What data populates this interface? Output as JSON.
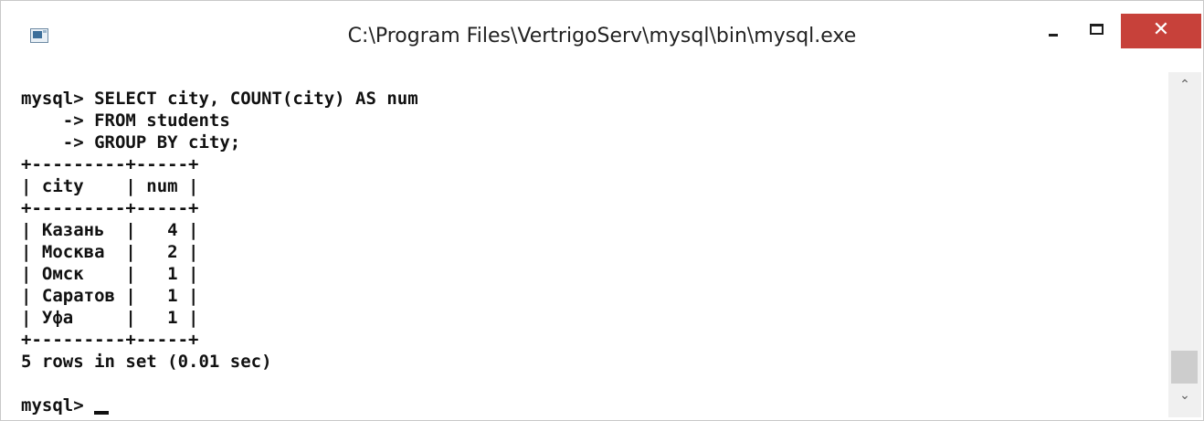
{
  "window": {
    "title": "C:\\Program Files\\VertrigoServ\\mysql\\bin\\mysql.exe",
    "icon": "console-app-icon",
    "controls": {
      "minimize": "minimize",
      "maximize": "maximize",
      "close_glyph": "✕"
    }
  },
  "console": {
    "lines": [
      "mysql> SELECT city, COUNT(city) AS num",
      "    -> FROM students",
      "    -> GROUP BY city;",
      "+---------+-----+",
      "| city    | num |",
      "+---------+-----+",
      "| Казань  |   4 |",
      "| Москва  |   2 |",
      "| Омск    |   1 |",
      "| Саратов |   1 |",
      "| Уфа     |   1 |",
      "+---------+-----+",
      "5 rows in set (0.01 sec)",
      "",
      "mysql> "
    ],
    "query_result": {
      "columns": [
        "city",
        "num"
      ],
      "rows": [
        [
          "Казань",
          "4"
        ],
        [
          "Москва",
          "2"
        ],
        [
          "Омск",
          "1"
        ],
        [
          "Саратов",
          "1"
        ],
        [
          "Уфа",
          "1"
        ]
      ],
      "summary": "5 rows in set (0.01 sec)"
    },
    "prompt": "mysql> "
  },
  "scrollbar": {
    "up_glyph": "⌃",
    "down_glyph": "⌄"
  },
  "colors": {
    "close_button": "#c7413a",
    "text": "#111111",
    "background": "#ffffff"
  }
}
